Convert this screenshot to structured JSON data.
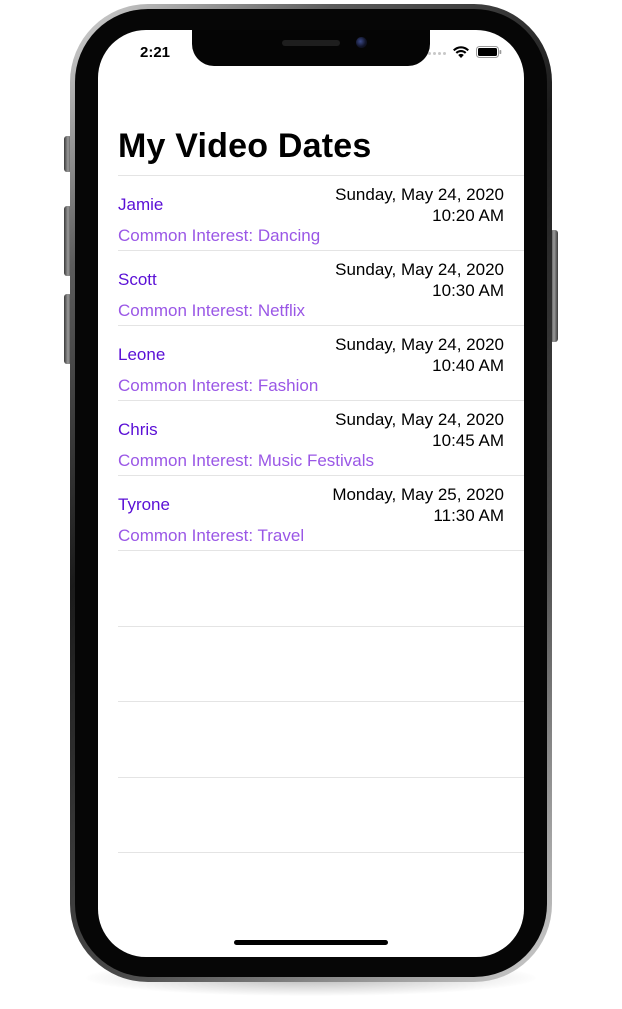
{
  "status_bar": {
    "time": "2:21"
  },
  "page": {
    "title": "My Video Dates"
  },
  "dates": [
    {
      "name": "Jamie",
      "date": "Sunday, May 24, 2020",
      "time": "10:20 AM",
      "interest": "Common Interest: Dancing"
    },
    {
      "name": "Scott",
      "date": "Sunday, May 24, 2020",
      "time": "10:30 AM",
      "interest": "Common Interest: Netflix"
    },
    {
      "name": "Leone",
      "date": "Sunday, May 24, 2020",
      "time": "10:40 AM",
      "interest": "Common Interest: Fashion"
    },
    {
      "name": "Chris",
      "date": "Sunday, May 24, 2020",
      "time": "10:45 AM",
      "interest": "Common Interest: Music Festivals"
    },
    {
      "name": "Tyrone",
      "date": "Monday, May 25, 2020",
      "time": "11:30 AM",
      "interest": "Common Interest: Travel"
    }
  ],
  "colors": {
    "name": "#5a0fd6",
    "interest": "#9a57e6",
    "separator": "#e4e4e4"
  },
  "icons": {
    "wifi": "wifi-icon",
    "battery": "battery-icon",
    "signal": "cellular-signal-icon"
  }
}
